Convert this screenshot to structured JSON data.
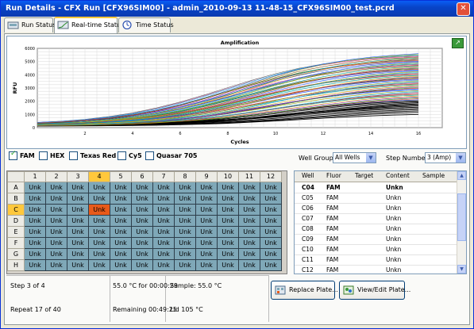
{
  "window": {
    "title": "Run Details - CFX Run [CFX96SIM00] - admin_2010-09-13 11-48-15_CFX96SIM00_test.pcrd",
    "close_glyph": "✕"
  },
  "tabs": [
    {
      "label": "Run Status",
      "icon": "run-status-icon"
    },
    {
      "label": "Real-time Status",
      "icon": "realtime-icon"
    },
    {
      "label": "Time Status",
      "icon": "clock-icon"
    }
  ],
  "chart_data": {
    "type": "line",
    "title": "Amplification",
    "xlabel": "Cycles",
    "ylabel": "RFU",
    "xlim": [
      0,
      17
    ],
    "ylim": [
      0,
      6000
    ],
    "xticks": [
      2,
      4,
      6,
      8,
      10,
      12,
      14,
      16
    ],
    "yticks": [
      0,
      1000,
      2000,
      3000,
      4000,
      5000,
      6000
    ],
    "x": [
      0,
      1,
      2,
      3,
      4,
      5,
      6,
      7,
      8,
      9,
      10,
      11,
      12,
      13,
      14,
      15,
      16
    ],
    "series_count": 72,
    "end_rfu_range": [
      1000,
      5600
    ],
    "grid": true
  },
  "dyes": [
    {
      "label": "FAM",
      "checked": true
    },
    {
      "label": "HEX",
      "checked": false
    },
    {
      "label": "Texas Red",
      "checked": false
    },
    {
      "label": "Cy5",
      "checked": false
    },
    {
      "label": "Quasar 705",
      "checked": false
    }
  ],
  "well_group": {
    "label": "Well Group:",
    "value": "All Wells"
  },
  "step_number": {
    "label": "Step Number:",
    "value": "3 (Amp)"
  },
  "plate": {
    "columns": [
      "1",
      "2",
      "3",
      "4",
      "5",
      "6",
      "7",
      "8",
      "9",
      "10",
      "11",
      "12"
    ],
    "rows": [
      "A",
      "B",
      "C",
      "D",
      "E",
      "F",
      "G",
      "H"
    ],
    "well_label": "Unk",
    "selected_row": "C",
    "selected_col": "4"
  },
  "well_table": {
    "headers": [
      "Well",
      "Fluor",
      "Target",
      "Content",
      "Sample"
    ],
    "rows": [
      {
        "well": "C04",
        "fluor": "FAM",
        "target": "",
        "content": "Unkn",
        "sample": "",
        "bold": true
      },
      {
        "well": "C05",
        "fluor": "FAM",
        "target": "",
        "content": "Unkn",
        "sample": ""
      },
      {
        "well": "C06",
        "fluor": "FAM",
        "target": "",
        "content": "Unkn",
        "sample": ""
      },
      {
        "well": "C07",
        "fluor": "FAM",
        "target": "",
        "content": "Unkn",
        "sample": ""
      },
      {
        "well": "C08",
        "fluor": "FAM",
        "target": "",
        "content": "Unkn",
        "sample": ""
      },
      {
        "well": "C09",
        "fluor": "FAM",
        "target": "",
        "content": "Unkn",
        "sample": ""
      },
      {
        "well": "C10",
        "fluor": "FAM",
        "target": "",
        "content": "Unkn",
        "sample": ""
      },
      {
        "well": "C11",
        "fluor": "FAM",
        "target": "",
        "content": "Unkn",
        "sample": ""
      },
      {
        "well": "C12",
        "fluor": "FAM",
        "target": "",
        "content": "Unkn",
        "sample": ""
      }
    ]
  },
  "status": {
    "step": "Step 3 of 4",
    "temp_hold": "55.0 °C for 00:00:29",
    "sample": "Sample: 55.0 °C",
    "repeat": "Repeat 17 of 40",
    "remaining": "Remaining 00:49:25",
    "lid": "Lid 105 °C"
  },
  "buttons": {
    "replace_plate": "Replace Plate...",
    "view_edit_plate": "View/Edit Plate..."
  },
  "colors": {
    "well": "#7fa8b8",
    "well_selected": "#e85a1a",
    "header_selected": "#ffc83c",
    "title_bar": "#0a5ef5"
  }
}
